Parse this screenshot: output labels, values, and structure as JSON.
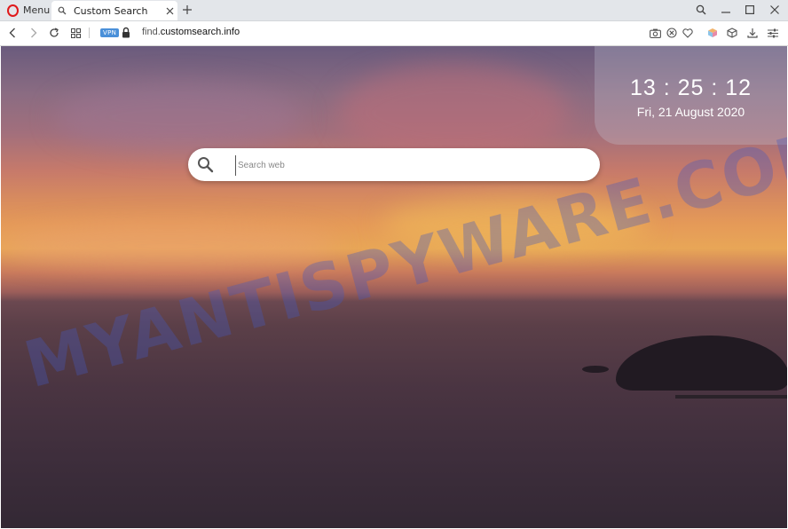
{
  "browser": {
    "menu_label": "Menu",
    "tab": {
      "title": "Custom Search"
    },
    "address": {
      "host_prefix": "find.",
      "host_domain": "customsearch.info"
    },
    "vpn_label": "VPN"
  },
  "page": {
    "clock": {
      "time": "13 : 25 : 12",
      "date": "Fri, 21 August 2020"
    },
    "search": {
      "placeholder": "Search web",
      "value": ""
    },
    "watermark": "MYANTISPYWARE.COM"
  },
  "colors": {
    "opera_red": "#e0191b",
    "vpn_blue": "#4a90d9"
  }
}
